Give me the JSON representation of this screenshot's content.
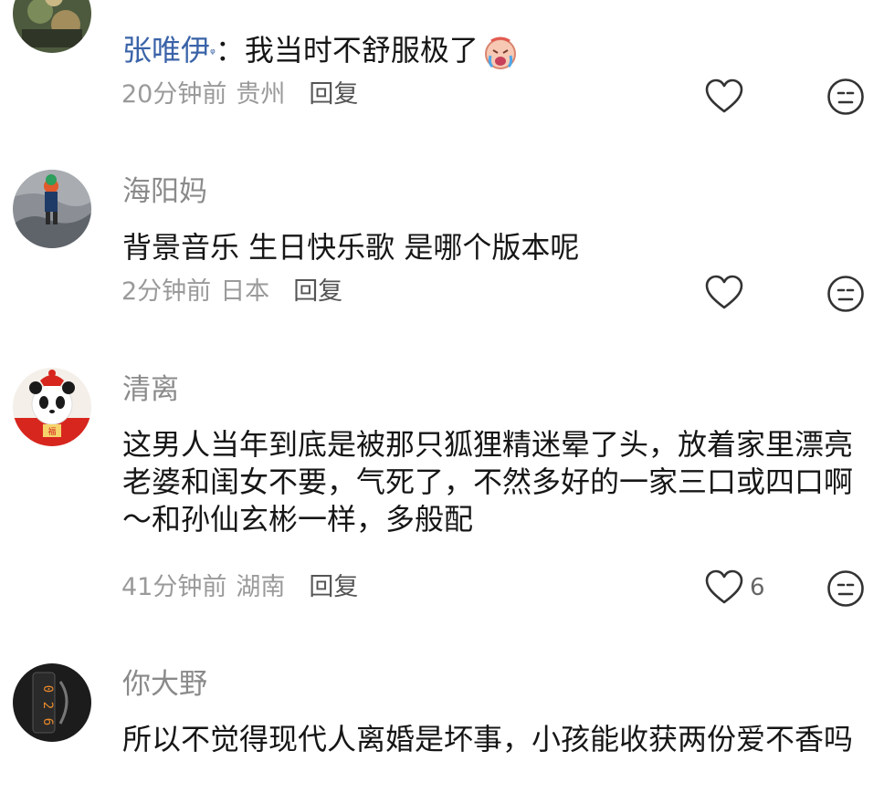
{
  "comments": [
    {
      "reply_author": "张唯伊",
      "reply_tag_icon": "search-icon",
      "text": "：我当时不舒服极了",
      "emoji": "crying-face-emoji",
      "time": "20分钟前",
      "location": "贵州",
      "reply_label": "回复"
    },
    {
      "username": "海阳妈",
      "text": "背景音乐 生日快乐歌 是哪个版本呢",
      "time": "2分钟前",
      "location": "日本",
      "reply_label": "回复"
    },
    {
      "username": "清离",
      "text": "这男人当年到底是被那只狐狸精迷晕了头，放着家里漂亮老婆和闺女不要，气死了，不然多好的一家三口或四口啊～和孙仙玄彬一样，多般配",
      "time": "41分钟前",
      "location": "湖南",
      "reply_label": "回复",
      "likes": "6"
    },
    {
      "username": "你大野",
      "text": "所以不觉得现代人离婚是坏事，小孩能收获两份爱不香吗"
    }
  ],
  "colors": {
    "username": "#8a8a8a",
    "text": "#161616",
    "meta": "#9a9a9a",
    "reply_link": "#3a63a8"
  }
}
